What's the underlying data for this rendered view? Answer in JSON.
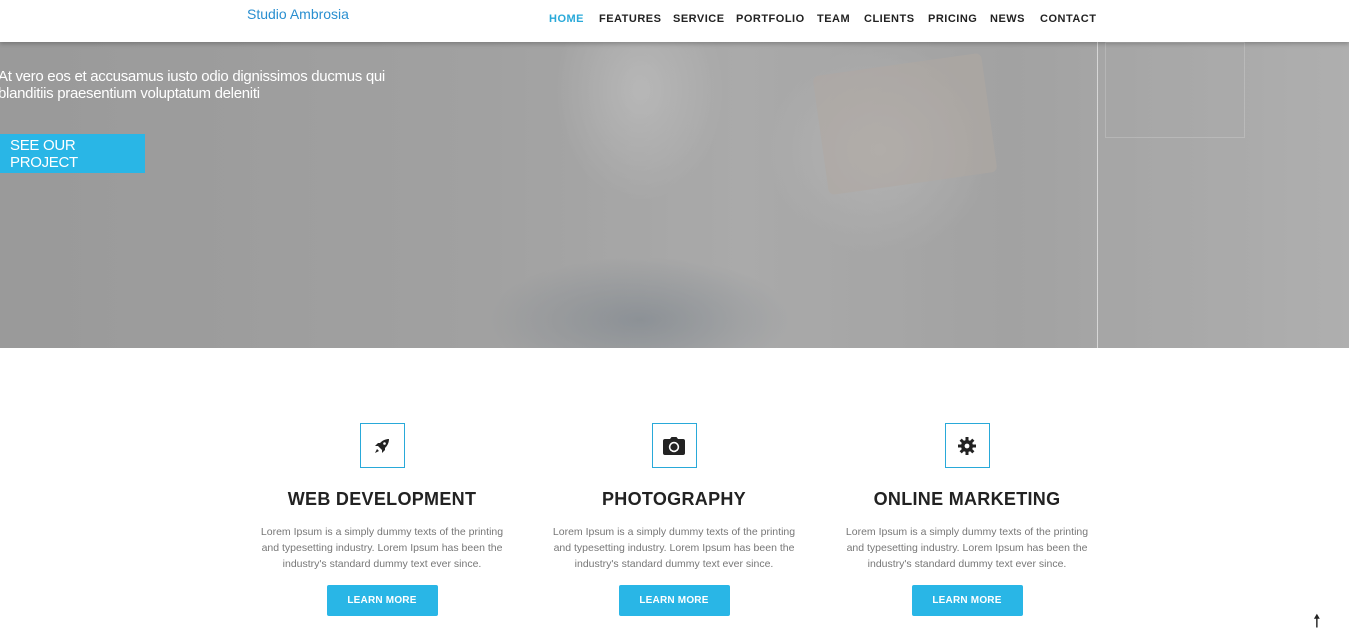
{
  "header": {
    "brand": "Studio Ambrosia",
    "nav": [
      "HOME",
      "FEATURES",
      "SERVICE",
      "PORTFOLIO",
      "TEAM",
      "CLIENTS",
      "PRICING",
      "NEWS",
      "CONTACT"
    ],
    "active": "HOME",
    "accent_color": "#29a9d9"
  },
  "hero": {
    "text_line1": "At vero eos et accusamus iusto odio dignissimos ducmus qui",
    "text_line2": "blanditiis praesentium voluptatum deleniti",
    "button_label": "SEE OUR PROJECT"
  },
  "services": [
    {
      "icon": "rocket-icon",
      "title": "WEB DEVELOPMENT",
      "text": "Lorem Ipsum is a simply dummy texts of the printing and typesetting industry. Lorem Ipsum has been the industry's standard dummy text ever since.",
      "button": "LEARN MORE"
    },
    {
      "icon": "camera-icon",
      "title": "PHOTOGRAPHY",
      "text": "Lorem Ipsum is a simply dummy texts of the printing and typesetting industry. Lorem Ipsum has been the industry's standard dummy text ever since.",
      "button": "LEARN MORE"
    },
    {
      "icon": "gear-icon",
      "title": "ONLINE MARKETING",
      "text": "Lorem Ipsum is a simply dummy texts of the printing and typesetting industry. Lorem Ipsum has been the industry's standard dummy text ever since.",
      "button": "LEARN MORE"
    }
  ],
  "scroll_top_icon": "arrow-up-icon",
  "scroll_top_glyph": "🠕",
  "button_color": "#29b6e6"
}
